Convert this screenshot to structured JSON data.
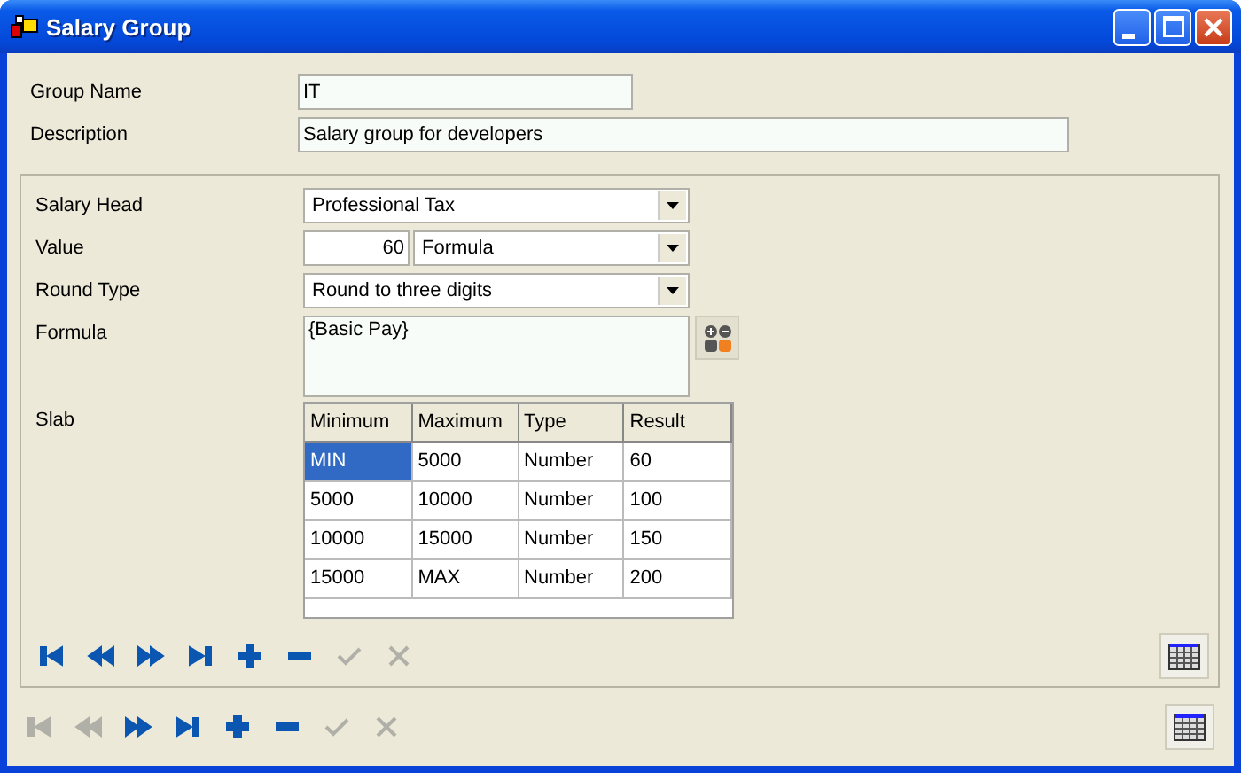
{
  "window": {
    "title": "Salary Group"
  },
  "group_name": {
    "label": "Group Name",
    "value": "IT"
  },
  "description": {
    "label": "Description",
    "value": "Salary group for developers"
  },
  "salary_head": {
    "label": "Salary Head",
    "value": "Professional Tax"
  },
  "value": {
    "label": "Value",
    "amount": "60",
    "type": "Formula"
  },
  "round_type": {
    "label": "Round Type",
    "value": "Round to three digits"
  },
  "formula": {
    "label": "Formula",
    "value": "{Basic Pay}"
  },
  "slab": {
    "label": "Slab",
    "columns": [
      "Minimum",
      "Maximum",
      "Type",
      "Result"
    ],
    "rows": [
      {
        "cells": [
          "MIN",
          "5000",
          "Number",
          "60"
        ],
        "selected": true
      },
      {
        "cells": [
          "5000",
          "10000",
          "Number",
          "100"
        ],
        "selected": false
      },
      {
        "cells": [
          "10000",
          "15000",
          "Number",
          "150"
        ],
        "selected": false
      },
      {
        "cells": [
          "15000",
          "MAX",
          "Number",
          "200"
        ],
        "selected": false
      }
    ]
  },
  "inner_toolbar": [
    {
      "kind": "first",
      "disabled": false
    },
    {
      "kind": "prev",
      "disabled": false
    },
    {
      "kind": "next",
      "disabled": false
    },
    {
      "kind": "last",
      "disabled": false
    },
    {
      "kind": "add",
      "disabled": false
    },
    {
      "kind": "remove",
      "disabled": false
    },
    {
      "kind": "confirm",
      "disabled": true
    },
    {
      "kind": "cancel",
      "disabled": true
    }
  ],
  "outer_toolbar": [
    {
      "kind": "first",
      "disabled": true
    },
    {
      "kind": "prev",
      "disabled": true
    },
    {
      "kind": "next",
      "disabled": false
    },
    {
      "kind": "last",
      "disabled": false
    },
    {
      "kind": "add",
      "disabled": false
    },
    {
      "kind": "remove",
      "disabled": false
    },
    {
      "kind": "confirm",
      "disabled": true
    },
    {
      "kind": "cancel",
      "disabled": true
    }
  ]
}
